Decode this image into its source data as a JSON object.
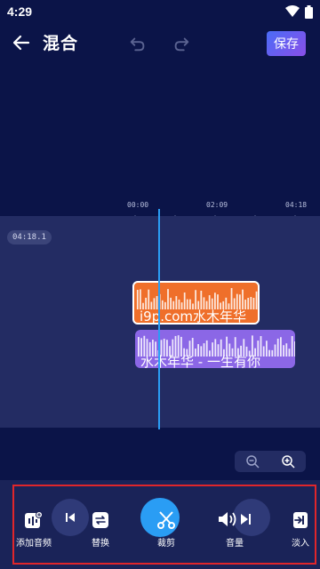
{
  "status_bar": {
    "time": "4:29"
  },
  "header": {
    "title": "混合",
    "save_label": "保存"
  },
  "timeline": {
    "ticks": [
      "00:00",
      "02:09",
      "04:18"
    ],
    "current_time": "04:18.1"
  },
  "tracks": [
    {
      "label": "i9p.com水木年华",
      "color": "#ef6f2a"
    },
    {
      "label": "水木年华 - 一生有你",
      "color": "#8b67e6"
    }
  ],
  "tools": {
    "add_audio": "添加音频",
    "replace": "替换",
    "trim": "裁剪",
    "volume": "音量",
    "fade_in": "淡入"
  },
  "colors": {
    "accent": "#2a9df4",
    "background": "#0b1448",
    "highlight": "#e0262b"
  }
}
